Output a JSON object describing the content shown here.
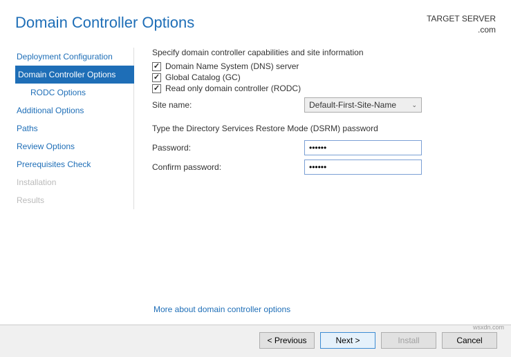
{
  "header": {
    "title": "Domain Controller Options",
    "target_label": "TARGET SERVER",
    "target_server": ".com"
  },
  "sidebar": {
    "items": [
      {
        "label": "Deployment Configuration",
        "state": "normal"
      },
      {
        "label": "Domain Controller Options",
        "state": "active"
      },
      {
        "label": "RODC Options",
        "state": "sub"
      },
      {
        "label": "Additional Options",
        "state": "normal"
      },
      {
        "label": "Paths",
        "state": "normal"
      },
      {
        "label": "Review Options",
        "state": "normal"
      },
      {
        "label": "Prerequisites Check",
        "state": "normal"
      },
      {
        "label": "Installation",
        "state": "disabled"
      },
      {
        "label": "Results",
        "state": "disabled"
      }
    ]
  },
  "main": {
    "caps_heading": "Specify domain controller capabilities and site information",
    "check_dns": "Domain Name System (DNS) server",
    "check_gc": "Global Catalog (GC)",
    "check_rodc": "Read only domain controller (RODC)",
    "sitename_label": "Site name:",
    "sitename_value": "Default-First-Site-Name",
    "dsrm_heading": "Type the Directory Services Restore Mode (DSRM) password",
    "password_label": "Password:",
    "password_value": "••••••",
    "confirm_label": "Confirm password:",
    "confirm_value": "••••••",
    "more_link": "More about domain controller options"
  },
  "footer": {
    "previous": "< Previous",
    "next": "Next >",
    "install": "Install",
    "cancel": "Cancel"
  },
  "watermark": "wsxdn.com"
}
